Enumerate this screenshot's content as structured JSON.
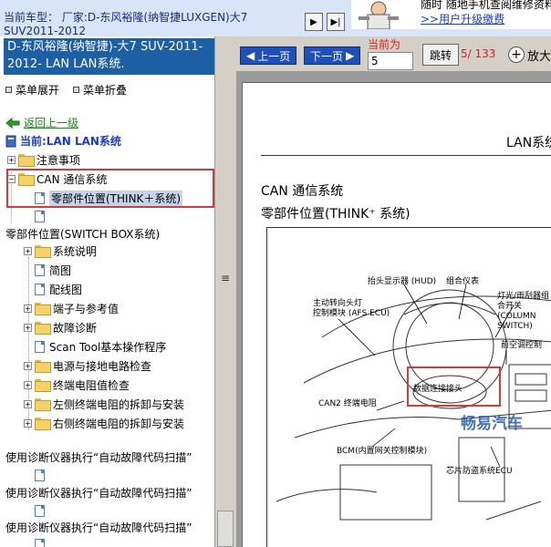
{
  "topbar": {
    "vehicle_label": "当前车型： 厂家:D-东风裕隆(纳智捷LUXGEN)大7",
    "vehicle_label_2": "SUV2011-2012",
    "nav_next": "▶",
    "nav_last": "▶|",
    "banner_line1": "随时 随地手机查阅维修资料",
    "banner_line2": ">>用户升级缴费"
  },
  "sidebar": {
    "header": "D-东风裕隆(纳智捷)-大7 SUV-2011-2012- LAN LAN系统.",
    "expand_all": "菜单展开",
    "collapse_all": "菜单折叠",
    "back_link": "返回上一级",
    "current": "当前:LAN LAN系统",
    "tree": {
      "notes": "注意事项",
      "can_system": "CAN 通信系统",
      "can_parts_location": "零部件位置(THINK＋系统)",
      "switch_box_parts": "零部件位置(SWITCH BOX系统)",
      "system_description": "系统说明",
      "diagram": "简图",
      "wiring_diagram": "配线图",
      "terminals_reference": "端子与参考值",
      "fault_diagnosis": "故障诊断",
      "scan_tool": "Scan Tool基本操作程序",
      "power_ground_check": "电源与接地电路检查",
      "terminal_resistance_check": "终端电阻值检查",
      "left_terminal_resistor": "左侧终端电阻的拆卸与安装",
      "right_terminal_resistor": "右侧终端电阻的拆卸与安装",
      "auto_scan_1": "使用诊断仪器执行“自动故障代码扫描”",
      "auto_scan_2": "使用诊断仪器执行“自动故障代码扫描”",
      "auto_scan_3": "使用诊断仪器执行“自动故障代码扫描”"
    }
  },
  "viewer": {
    "prev_page": "上一页",
    "next_page": "下一页",
    "current_page_label": "当前为",
    "page_input_value": "5",
    "jump_button": "跳转",
    "page_count": "5/ 133",
    "zoom_label": "放大",
    "page": {
      "header": "LAN系统",
      "section_title": "CAN 通信系统",
      "subsection_title": "零部件位置(THINK⁺ 系统)",
      "diagram_labels": {
        "hud": "抬头显示器 (HUD)",
        "cluster": "组合仪表",
        "afs": "主动转向头灯\n控制模块 (AFS ECU)",
        "column_switch": "灯光/雨刮器组合开关\n(COLUMN SWITCH)",
        "ac_control": "前空调控制",
        "dlc": "数据连接接头",
        "can2_terminal": "CAN2 终端电阻",
        "bcm": "BCM(内置网关控制模块)",
        "immobilizer": "芯片防盗系统ECU"
      },
      "watermark": "畅易汽车"
    }
  }
}
